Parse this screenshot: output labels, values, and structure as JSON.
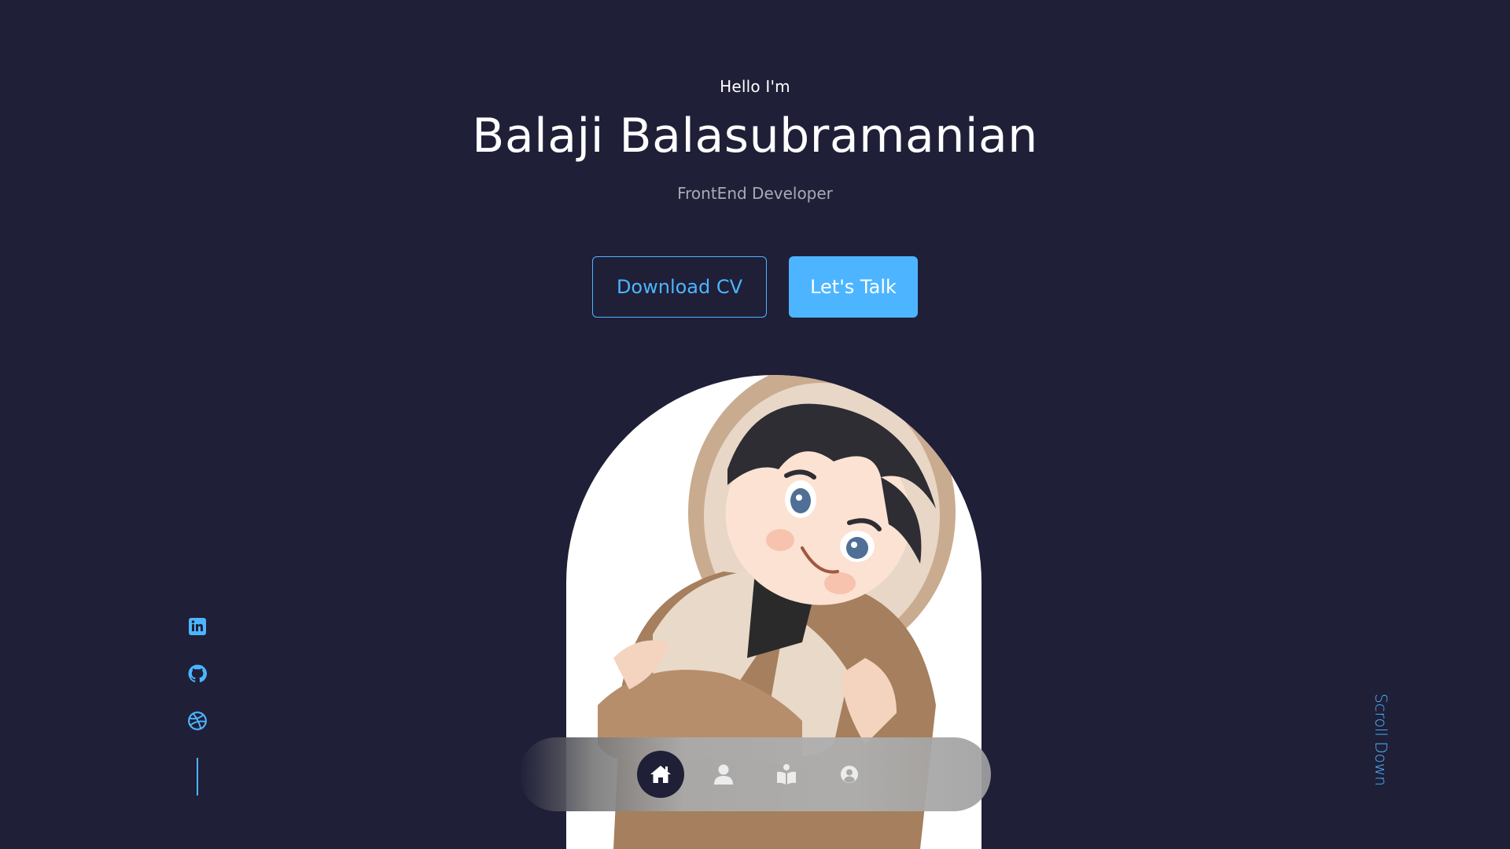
{
  "header": {
    "greeting": "Hello I'm",
    "name": "Balaji Balasubramanian",
    "role": "FrontEnd Developer"
  },
  "cta": {
    "download_cv_label": "Download CV",
    "lets_talk_label": "Let's Talk"
  },
  "socials": [
    {
      "icon": "linkedin-icon"
    },
    {
      "icon": "github-icon"
    },
    {
      "icon": "dribbble-icon"
    }
  ],
  "scroll_down_label": "Scroll Down",
  "nav": {
    "items": [
      {
        "icon": "home-icon",
        "active": true
      },
      {
        "icon": "user-icon",
        "active": false
      },
      {
        "icon": "book-icon",
        "active": false
      },
      {
        "icon": "user-circle-icon",
        "active": false
      }
    ]
  },
  "colors": {
    "background": "#1f1f38",
    "primary": "#4db5ff",
    "text": "#ffffff",
    "text_light": "rgba(255,255,255,0.62)"
  }
}
